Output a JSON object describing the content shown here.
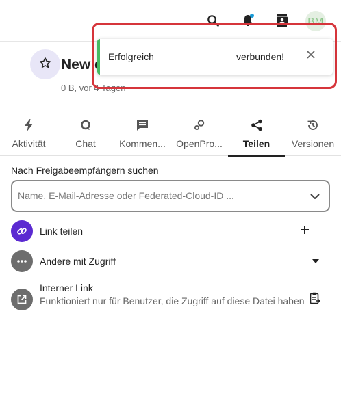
{
  "header": {
    "avatar_initials": "BM",
    "icons": [
      "search-icon",
      "notifications-icon",
      "contacts-icon"
    ],
    "notification_dot_color": "#1a9bd7"
  },
  "file": {
    "title": "New d",
    "meta": "0 B, vor 4 Tagen",
    "favorite_icon": "star-icon"
  },
  "toast": {
    "part1": "Erfolgreich",
    "part2": "verbunden!",
    "accent_color": "#46ba61",
    "close_icon": "close-icon"
  },
  "tabs": [
    {
      "label": "Aktivität",
      "icon": "activity-icon"
    },
    {
      "label": "Chat",
      "icon": "chat-icon"
    },
    {
      "label": "Kommen...",
      "icon": "comments-icon"
    },
    {
      "label": "OpenPro...",
      "icon": "openproject-icon"
    },
    {
      "label": "Teilen",
      "icon": "share-icon",
      "active": true
    },
    {
      "label": "Versionen",
      "icon": "history-icon"
    }
  ],
  "sharing": {
    "search_label": "Nach Freigabeempfängern suchen",
    "search_placeholder": "Name, E-Mail-Adresse oder Federated-Cloud-ID ...",
    "share_link_label": "Link teilen",
    "others_with_access_label": "Andere mit Zugriff",
    "internal_link_label": "Interner Link",
    "internal_link_description": "Funktioniert nur für Benutzer, die Zugriff auf diese Datei haben",
    "link_color": "#5b2ad1"
  }
}
